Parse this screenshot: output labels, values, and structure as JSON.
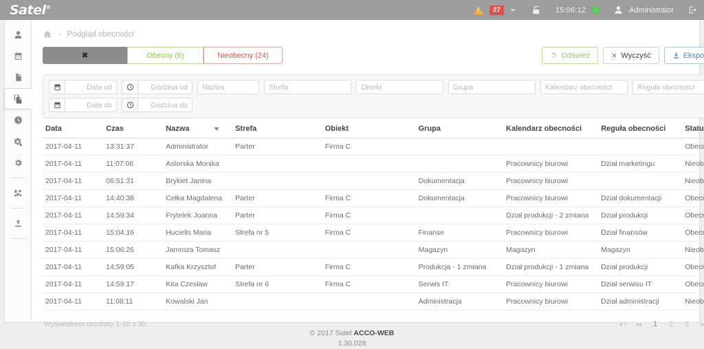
{
  "topbar": {
    "logo": "Satel",
    "logo_sup": "®",
    "alert_count": "27",
    "time": "15:06:12",
    "user": "Administrator",
    "icons": {
      "warning": "warning-triangle-icon",
      "lock": "unlocked-padlock-icon",
      "status": "green-status-dot",
      "user": "user-icon",
      "logout": "logout-icon"
    }
  },
  "sidebar": {
    "items": [
      {
        "name": "users",
        "icon": "user-icon"
      },
      {
        "name": "calendar",
        "icon": "calendar-icon"
      },
      {
        "name": "reports",
        "icon": "document-icon"
      },
      {
        "name": "presence",
        "icon": "copy-files-icon",
        "active": true
      },
      {
        "name": "history",
        "icon": "globe-clock-icon"
      },
      {
        "name": "configuration",
        "icon": "gears-icon"
      },
      {
        "name": "settings",
        "icon": "gear-icon"
      },
      {
        "name": "network",
        "icon": "network-nodes-icon"
      },
      {
        "name": "import",
        "icon": "upload-icon"
      }
    ]
  },
  "breadcrumb": {
    "home_icon": "home-icon",
    "separator": "›",
    "current": "Podgląd obecności"
  },
  "segmented": {
    "clear_label": "✖",
    "present_label": "Obecny (6)",
    "absent_label": "Nieobecny (24)",
    "present_color": "#93c552",
    "absent_color": "#d9534f"
  },
  "toolbar": {
    "refresh_label": "Odśwież",
    "clear_label": "Wyczyść",
    "export_label": "Eksport",
    "refresh_color": "#9fc964",
    "export_color": "#4b87c4"
  },
  "filters": {
    "date_from": "Data od",
    "date_to": "Data do",
    "time_from": "Godzina od",
    "time_to": "Godzina do",
    "nazwa": "Nazwa",
    "strefa": "Strefa",
    "obiekt": "Obiekt",
    "grupa": "Grupa",
    "kalendarz": "Kalendarz obecności",
    "regula": "Reguła obecności",
    "values": {
      "date_from": "",
      "date_to": "",
      "time_from": "",
      "time_to": "",
      "nazwa": "",
      "strefa": "",
      "obiekt": "",
      "grupa": "",
      "kalendarz": "",
      "regula": ""
    }
  },
  "table": {
    "columns": [
      "Data",
      "Czas",
      "Nazwa",
      "Strefa",
      "Obiekt",
      "Grupa",
      "Kalendarz obecności",
      "Reguła obecności",
      "Status"
    ],
    "sorted_column": "Nazwa",
    "sort_direction": "desc",
    "rows": [
      {
        "data": "2017-04-11",
        "czas": "13:31:37",
        "nazwa": "Administrator",
        "strefa": "Parter",
        "obiekt": "Firma C",
        "grupa": "",
        "kalendarz": "",
        "regula": "",
        "status": "Obecny"
      },
      {
        "data": "2017-04-11",
        "czas": "11:07:06",
        "nazwa": "Astorska Monika",
        "strefa": "",
        "obiekt": "",
        "grupa": "",
        "kalendarz": "Pracownicy biurowi",
        "regula": "Dział marketingu",
        "status": "Nieobecny"
      },
      {
        "data": "2017-04-11",
        "czas": "06:51:31",
        "nazwa": "Brykiet Janina",
        "strefa": "",
        "obiekt": "",
        "grupa": "Dokumentacja",
        "kalendarz": "Pracownicy biurowi",
        "regula": "",
        "status": "Nieobecny"
      },
      {
        "data": "2017-04-11",
        "czas": "14:40:38",
        "nazwa": "Cełka Magdalena",
        "strefa": "Parter",
        "obiekt": "Firma C",
        "grupa": "Dokumentacja",
        "kalendarz": "Pracownicy biurowi",
        "regula": "Dział dokumentacji",
        "status": "Obecny"
      },
      {
        "data": "2017-04-11",
        "czas": "14:59:34",
        "nazwa": "Frytelek Joanna",
        "strefa": "Parter",
        "obiekt": "Firma C",
        "grupa": "",
        "kalendarz": "Dział produkcji - 2 zmiana",
        "regula": "Dział produkcji",
        "status": "Obecny"
      },
      {
        "data": "2017-04-11",
        "czas": "15:04:16",
        "nazwa": "Hucielis Maria",
        "strefa": "Strefa nr 5",
        "obiekt": "Firma C",
        "grupa": "Finanse",
        "kalendarz": "Pracownicy biurowi",
        "regula": "Dział finansów",
        "status": "Obecny"
      },
      {
        "data": "2017-04-11",
        "czas": "15:06:26",
        "nazwa": "Jamroza Tomasz",
        "strefa": "",
        "obiekt": "",
        "grupa": "Magazyn",
        "kalendarz": "Magazyn",
        "regula": "Magazyn",
        "status": "Nieobecny"
      },
      {
        "data": "2017-04-11",
        "czas": "14:59:05",
        "nazwa": "Kafka Krzysztof",
        "strefa": "Parter",
        "obiekt": "Firma C",
        "grupa": "Produkcja - 1 zmiana",
        "kalendarz": "Dział produkcji - 1 zmiana",
        "regula": "Dział produkcji",
        "status": "Obecny"
      },
      {
        "data": "2017-04-11",
        "czas": "14:59:17",
        "nazwa": "Kita Czesław",
        "strefa": "Strefa nr 6",
        "obiekt": "Firma C",
        "grupa": "Serwis IT",
        "kalendarz": "Pracownicy biurowi",
        "regula": "Dział serwisu IT",
        "status": "Obecny"
      },
      {
        "data": "2017-04-11",
        "czas": "11:08:11",
        "nazwa": "Kowalski Jan",
        "strefa": "",
        "obiekt": "",
        "grupa": "Administracja",
        "kalendarz": "Pracownicy biurowi",
        "regula": "Dział administracji",
        "status": "Nieobecny"
      }
    ]
  },
  "pagination": {
    "results_text": "Wyświetlono rezultaty 1-10 z 30.",
    "pages": [
      "1",
      "2",
      "3"
    ],
    "active_page": "1",
    "active_color": "#5b9bd5"
  },
  "footer": {
    "copyright_prefix": "© 2017 Satel ",
    "product": "ACCO-WEB",
    "version": "1.30.028"
  }
}
